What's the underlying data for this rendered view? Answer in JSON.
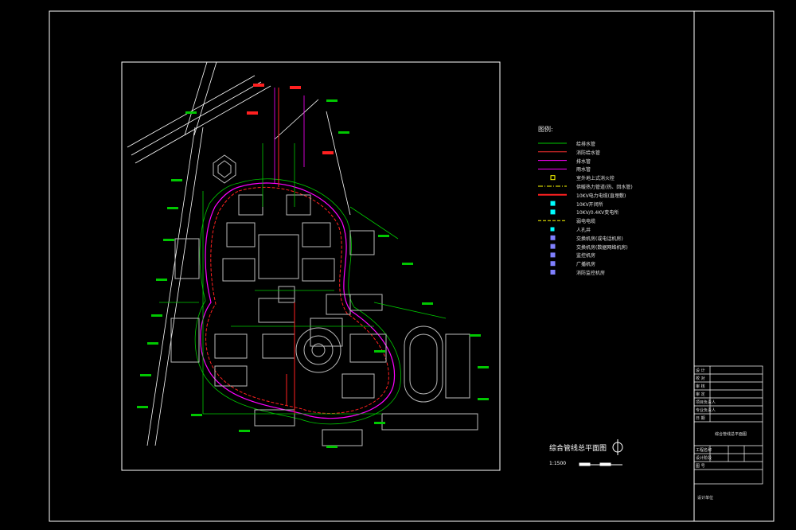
{
  "legend": {
    "title": "图例:",
    "items": [
      {
        "label": "给排水管",
        "color": "#00c800",
        "kind": "line"
      },
      {
        "label": "消防给水管",
        "color": "#ff3030",
        "kind": "line"
      },
      {
        "label": "排水管",
        "color": "#ff00ff",
        "kind": "line"
      },
      {
        "label": "雨水管",
        "color": "#ff00ff",
        "kind": "line"
      },
      {
        "label": "室外地上式消火栓",
        "color": "#ffff00",
        "kind": "symbol"
      },
      {
        "label": "供暖热力管道(热、回水管)",
        "color": "#ffff00",
        "kind": "dashdot"
      },
      {
        "label": "10KV电力电缆(直埋敷)",
        "color": "#ff2020",
        "kind": "thick"
      },
      {
        "label": "10KV开闭所",
        "color": "#00ffff",
        "kind": "box"
      },
      {
        "label": "10KV/0.4KV变电所",
        "color": "#00ffff",
        "kind": "box"
      },
      {
        "label": "弱电电缆",
        "color": "#ffff00",
        "kind": "dash"
      },
      {
        "label": "人孔井",
        "color": "#00ffff",
        "kind": "smallbox"
      },
      {
        "label": "交换机房(或电话机房)",
        "color": "#8080ff",
        "kind": "box"
      },
      {
        "label": "交换机房(数据网络机房)",
        "color": "#8080ff",
        "kind": "box"
      },
      {
        "label": "监控机房",
        "color": "#8080ff",
        "kind": "box"
      },
      {
        "label": "广播机房",
        "color": "#8080ff",
        "kind": "box"
      },
      {
        "label": "消防监控机房",
        "color": "#8080ff",
        "kind": "box"
      }
    ]
  },
  "drawing": {
    "title": "综合管线总平面图",
    "scale": "1:1500"
  },
  "title_block": {
    "rows": [
      "设 计",
      "校 对",
      "审 核",
      "审 定",
      "项目负责人",
      "专业负责人",
      "日 期",
      "工程名称",
      "设计阶段",
      "图 号"
    ],
    "sheet_caption": "综合管线总平面图",
    "footer": "设计单位"
  },
  "colors": {
    "background": "#000000",
    "frame": "#ffffff",
    "green": "#00c800",
    "red": "#ff2020",
    "magenta": "#ff00ff",
    "cyan": "#00ffff",
    "yellow": "#ffff00"
  }
}
